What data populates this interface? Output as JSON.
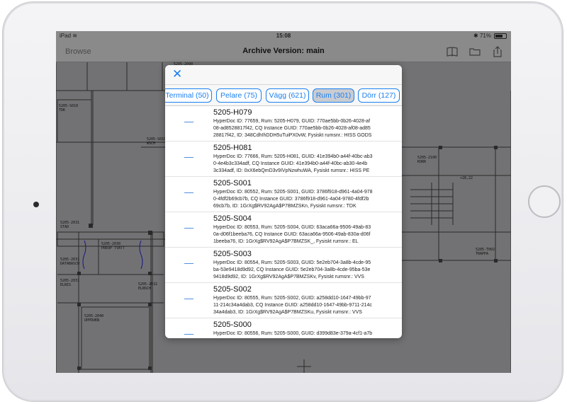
{
  "statusbar": {
    "device": "iPad",
    "time": "15:08",
    "battery": "71%",
    "battery_level": 0.71
  },
  "navbar": {
    "back_label": "Browse",
    "title": "Archive Version: main",
    "icons": [
      "book-icon",
      "folder-icon",
      "share-icon"
    ]
  },
  "plan_labels": [
    {
      "text": "5205-2090"
    },
    {
      "text": "5205-S010\nTDK"
    },
    {
      "text": "5205-S010\nWSCH"
    },
    {
      "text": "5205-2100\nKORR"
    },
    {
      "text": "+28,22"
    },
    {
      "text": "5205-2031\nSTAD"
    },
    {
      "text": "5205-2030\nPREOP TVATT"
    },
    {
      "text": "5205-2031\nDATABASCH"
    },
    {
      "text": "5205-2031\nELNIS"
    },
    {
      "text": "5205-2032\nELNSCH"
    },
    {
      "text": "5205-2040\nUPPDUKN"
    },
    {
      "text": "5205-T002\nTRAPPA"
    }
  ],
  "popover": {
    "close_icon": "close-icon",
    "filters": [
      {
        "label": "Terminal (50)",
        "active": false
      },
      {
        "label": "Pelare (75)",
        "active": false
      },
      {
        "label": "Vägg (621)",
        "active": false
      },
      {
        "label": "Rum (301)",
        "active": true
      },
      {
        "label": "Dörr (127)",
        "active": false
      }
    ],
    "items": [
      {
        "name": "5205-H079",
        "details": "HyperDoc ID: 77659, Rum: 5205-H079, GUID: 770ae5bb-0b26-4028-af\n08-ad8528817f42, CQ Instance GUID: 770ae5bb-0b26-4028-af08-ad85\n28817f42, ID: 348CdhIhDDH5uTuiPX0vW, Fysiskt rumsnr.: HISS GODS"
      },
      {
        "name": "5205-H081",
        "details": "HyperDoc ID: 77666, Rum: 5205-H081, GUID: 41e394b0-a44f-40bc-ab3\n0-4e4b3c334adf, CQ Instance GUID: 41e394b0-a44f-40bc-ab30-4e4b\n3c334adf, ID: 0xX6ebQmD3v9IVpNzwhuWA, Fysiskt rumsnr.: HISS PE"
      },
      {
        "name": "5205-S001",
        "details": "HyperDoc ID: 80552, Rum: 5205-S001, GUID: 3786f918-d961-4a04-978\n0-4fdf2b69cb7b, CQ Instance GUID: 3786f918-d961-4a04-9780-4fdf2b\n69cb7b, ID: 1GrXg$RV92AgA$P7BMZSKn, Fysiskt rumsnr.: TDK"
      },
      {
        "name": "5205-S004",
        "details": "HyperDoc ID: 80553, Rum: 5205-S004, GUID: 63aca66a-9506-49ab-83\n0a-d06f1beeba76, CQ Instance GUID: 63aca66a-9506-49ab-830a-d06f\n1beeba76, ID: 1GrXg$RV92AgA$P7BMZSK_, Fysiskt rumsnr.: EL"
      },
      {
        "name": "5205-S003",
        "details": "HyperDoc ID: 80554, Rum: 5205-S003, GUID: 5e2eb704-3a8b-4cde-95\nba-53e9418d9d92, CQ Instance GUID: 5e2eb704-3a8b-4cde-95ba-53e\n9418d9d92, ID: 1GrXg$RV92AgA$P7BMZSKv, Fysiskt rumsnr.: VVS"
      },
      {
        "name": "5205-S002",
        "details": "HyperDoc ID: 80555, Rum: 5205-S002, GUID: a258dd10-1647-49bb-97\n11-214c34a4dab3, CQ Instance GUID: a258dd10-1647-49bb-9711-214c\n34a4dab3, ID: 1GrXg$RV92AgA$P7BMZSKu, Fysiskt rumsnr.: VVS"
      },
      {
        "name": "5205-S000",
        "details": "HyperDoc ID: 80556, Rum: 5205-S000, GUID: d399d83e-379a-4cf1-a7b"
      }
    ]
  }
}
